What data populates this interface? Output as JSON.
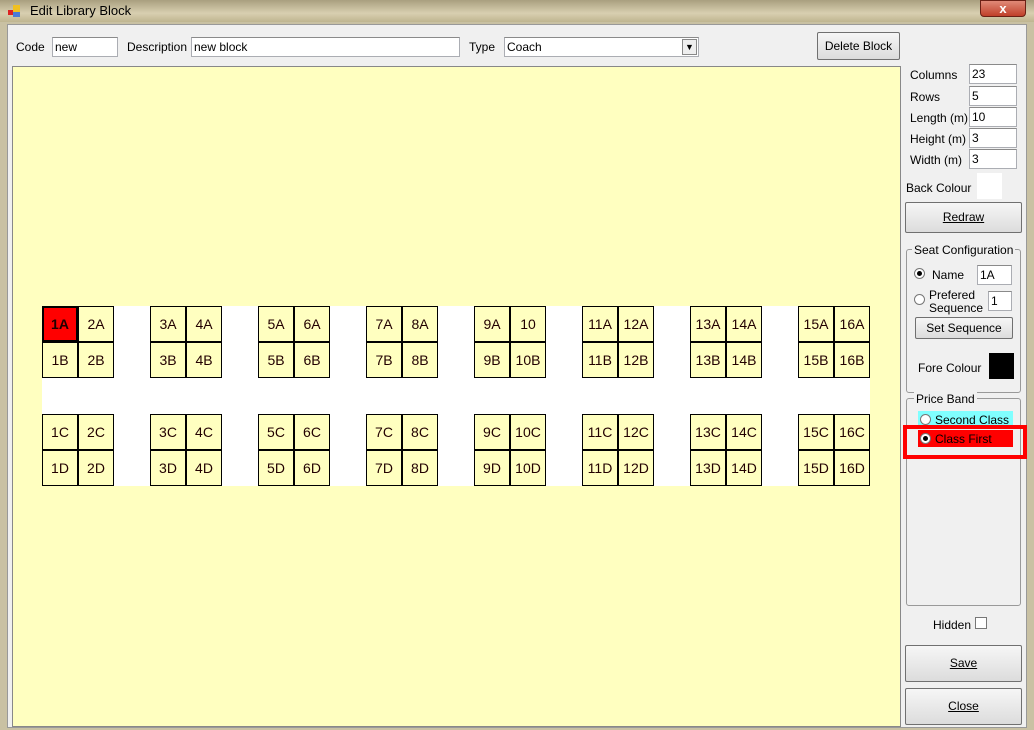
{
  "window": {
    "title": "Edit Library Block",
    "close": "x"
  },
  "header": {
    "code_label": "Code",
    "code_value": "new",
    "description_label": "Description",
    "description_value": "new block",
    "type_label": "Type",
    "type_value": "Coach",
    "delete_label": "Delete Block"
  },
  "grid": {
    "columns": 23,
    "rows": 5,
    "seat_columns": [
      0,
      1,
      3,
      4,
      6,
      7,
      9,
      10,
      12,
      13,
      15,
      16,
      18,
      19,
      21,
      22
    ],
    "aisle_row": 2,
    "selected": "1A",
    "selected_color": "#ff0000",
    "seat_rows": [
      [
        "1A",
        "2A",
        "3A",
        "4A",
        "5A",
        "6A",
        "7A",
        "8A",
        "9A",
        "10",
        "11A",
        "12A",
        "13A",
        "14A",
        "15A",
        "16A"
      ],
      [
        "1B",
        "2B",
        "3B",
        "4B",
        "5B",
        "6B",
        "7B",
        "8B",
        "9B",
        "10B",
        "11B",
        "12B",
        "13B",
        "14B",
        "15B",
        "16B"
      ],
      [
        "1C",
        "2C",
        "3C",
        "4C",
        "5C",
        "6C",
        "7C",
        "8C",
        "9C",
        "10C",
        "11C",
        "12C",
        "13C",
        "14C",
        "15C",
        "16C"
      ],
      [
        "1D",
        "2D",
        "3D",
        "4D",
        "5D",
        "6D",
        "7D",
        "8D",
        "9D",
        "10D",
        "11D",
        "12D",
        "13D",
        "14D",
        "15D",
        "16D"
      ]
    ]
  },
  "props": {
    "columns_label": "Columns",
    "columns": "23",
    "rows_label": "Rows",
    "rows": "5",
    "length_label": "Length (m)",
    "length": "10",
    "height_label": "Height (m)",
    "height": "3",
    "width_label": "Width (m)",
    "width": "3",
    "back_colour_label": "Back Colour",
    "back_colour": "#ffffff",
    "redraw": "Redraw"
  },
  "seat_config": {
    "title": "Seat Configuration",
    "name_label": "Name",
    "name_value": "1A",
    "pref_label_1": "Prefered",
    "pref_label_2": "Sequence",
    "pref_value": "1",
    "set_sequence": "Set Sequence",
    "fore_colour_label": "Fore Colour",
    "fore_colour": "#000000"
  },
  "price_band": {
    "title": "Price Band",
    "options": [
      {
        "label": "Second Class",
        "color": "#80ffff",
        "selected": false
      },
      {
        "label": "Class First",
        "color": "#ff0000",
        "selected": true
      }
    ],
    "highlight_color": "#ff0000"
  },
  "hidden_label": "Hidden",
  "hidden_checked": false,
  "save": "Save",
  "close": "Close"
}
